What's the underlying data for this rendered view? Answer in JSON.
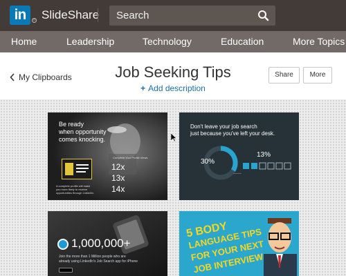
{
  "header": {
    "logo_text": "in",
    "logo_reg": "®",
    "brand": "SlideShare",
    "search_placeholder": "Search"
  },
  "nav": {
    "items": [
      "Home",
      "Leadership",
      "Technology",
      "Education",
      "More Topics"
    ]
  },
  "clipboard": {
    "back_label": "My Clipboards",
    "title": "Job Seeking Tips",
    "add_description": "Add description",
    "share_label": "Share",
    "more_label": "More"
  },
  "cards": {
    "card1": {
      "heading_line1": "Be ready",
      "heading_line2": "when opportunity",
      "heading_line3": "comes knocking.",
      "caption": "Complete Your Profile Views",
      "stats": [
        "12x",
        "13x",
        "14x"
      ],
      "footnote_line1": "A complete profile will make",
      "footnote_line2": "you more likely to receive",
      "footnote_line3": "opportunities through LinkedIn."
    },
    "card2": {
      "heading_line1": "Don't leave your job search",
      "heading_line2": "just because you've left your desk.",
      "stat_left": "30%",
      "stat_right": "13%"
    },
    "card3": {
      "big_number": "1,000,000+",
      "line1": "Join the more than 1 Million people who are",
      "line2": "already using LinkedIn's Job Search app for iPhone"
    },
    "card4": {
      "line1": "5 BODY",
      "line2": "LANGUAGE TIPS",
      "line3": "FOR YOUR NEXT",
      "line4": "JOB INTERVIEW"
    }
  },
  "colors": {
    "header_bg": "#423b37",
    "nav_bg": "#716a66",
    "linkedin_blue": "#0a7ab6",
    "link_blue": "#1e6ea7",
    "card4_bg": "#2ba6cc",
    "card4_text": "#f5d81f"
  }
}
